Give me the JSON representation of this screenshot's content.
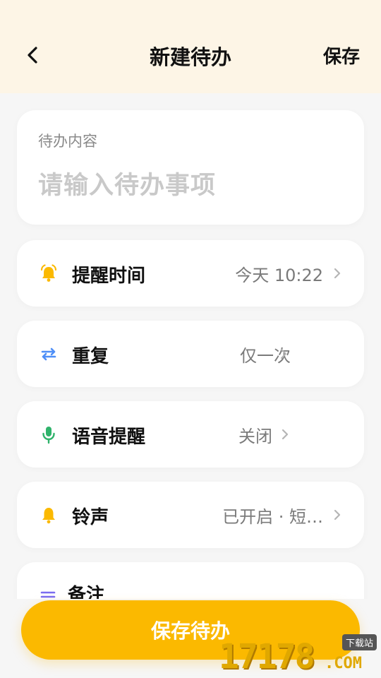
{
  "header": {
    "title": "新建待办",
    "save_label": "保存"
  },
  "todo_input": {
    "label": "待办内容",
    "placeholder": "请输入待办事项"
  },
  "rows": [
    {
      "label": "提醒时间",
      "value": "今天 10:22",
      "icon": "alarm-bell-icon",
      "icon_color": "#fbb900"
    },
    {
      "label": "重复",
      "value": "仅一次",
      "icon": "repeat-arrows-icon",
      "icon_color": "#4f8ff7"
    },
    {
      "label": "语音提醒",
      "value": "关闭",
      "icon": "microphone-icon",
      "icon_color": "#2fb36b"
    },
    {
      "label": "铃声",
      "value": "已开启 · 短…",
      "icon": "bell-icon",
      "icon_color": "#fbb900"
    },
    {
      "label": "备注",
      "value": "",
      "icon": "notes-lines-icon",
      "icon_color": "#7a6cf0"
    }
  ],
  "footer": {
    "save_button_label": "保存待办"
  },
  "watermark": {
    "number": "17178",
    "suffix": ".COM",
    "tag": "下载站"
  },
  "colors": {
    "accent": "#fbb900",
    "header_bg": "#fdf5e6"
  }
}
